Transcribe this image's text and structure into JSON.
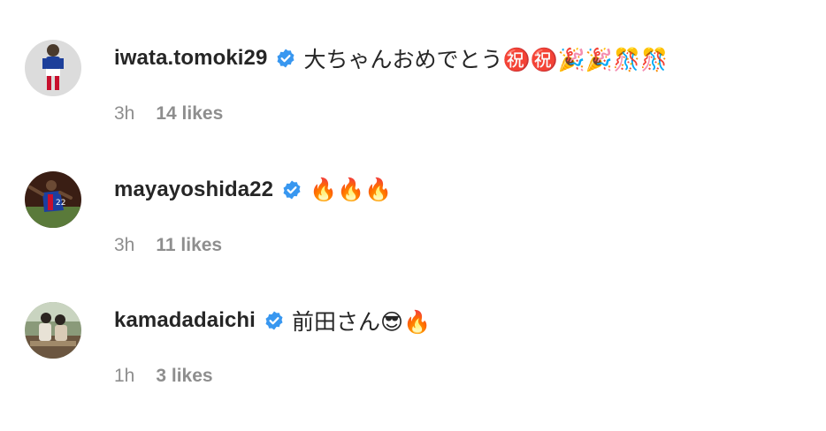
{
  "comments": [
    {
      "username": "iwata.tomoki29",
      "verified": true,
      "text": "大ちゃんおめでとう㊗️㊗️🎉🎉🎊🎊",
      "time": "3h",
      "likes": "14 likes"
    },
    {
      "username": "mayayoshida22",
      "verified": true,
      "text": "🔥🔥🔥",
      "time": "3h",
      "likes": "11 likes"
    },
    {
      "username": "kamadadaichi",
      "verified": true,
      "text": "前田さん😎🔥",
      "time": "1h",
      "likes": "3 likes"
    }
  ],
  "colors": {
    "verified_badge": "#3897f0",
    "username": "#262626",
    "meta": "#8e8e8e"
  }
}
